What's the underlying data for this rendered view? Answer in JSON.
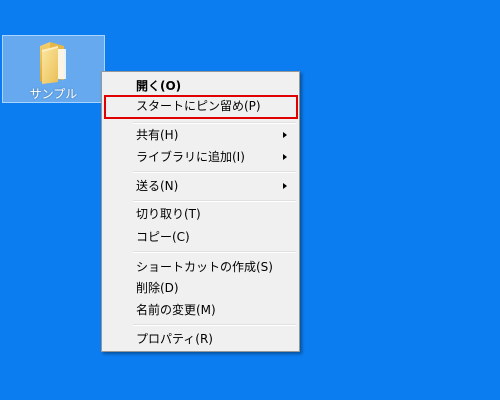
{
  "desktop": {
    "background_color": "#0c7df0",
    "selection_color": "#66a9ef"
  },
  "desktop_icon": {
    "label": "サンプル",
    "icon": "folder-icon"
  },
  "context_menu": {
    "background_color": "#f0f0f0",
    "highlight_color": "#e00000",
    "items": [
      {
        "label": "開く(O)",
        "default": true
      },
      {
        "label": "スタートにピン留め(P)",
        "highlighted": true
      },
      {
        "label": "共有(H)",
        "submenu": true
      },
      {
        "label": "ライブラリに追加(I)",
        "submenu": true
      },
      {
        "label": "送る(N)",
        "submenu": true
      },
      {
        "label": "切り取り(T)"
      },
      {
        "label": "コピー(C)"
      },
      {
        "label": "ショートカットの作成(S)"
      },
      {
        "label": "削除(D)"
      },
      {
        "label": "名前の変更(M)"
      },
      {
        "label": "プロパティ(R)"
      }
    ]
  }
}
